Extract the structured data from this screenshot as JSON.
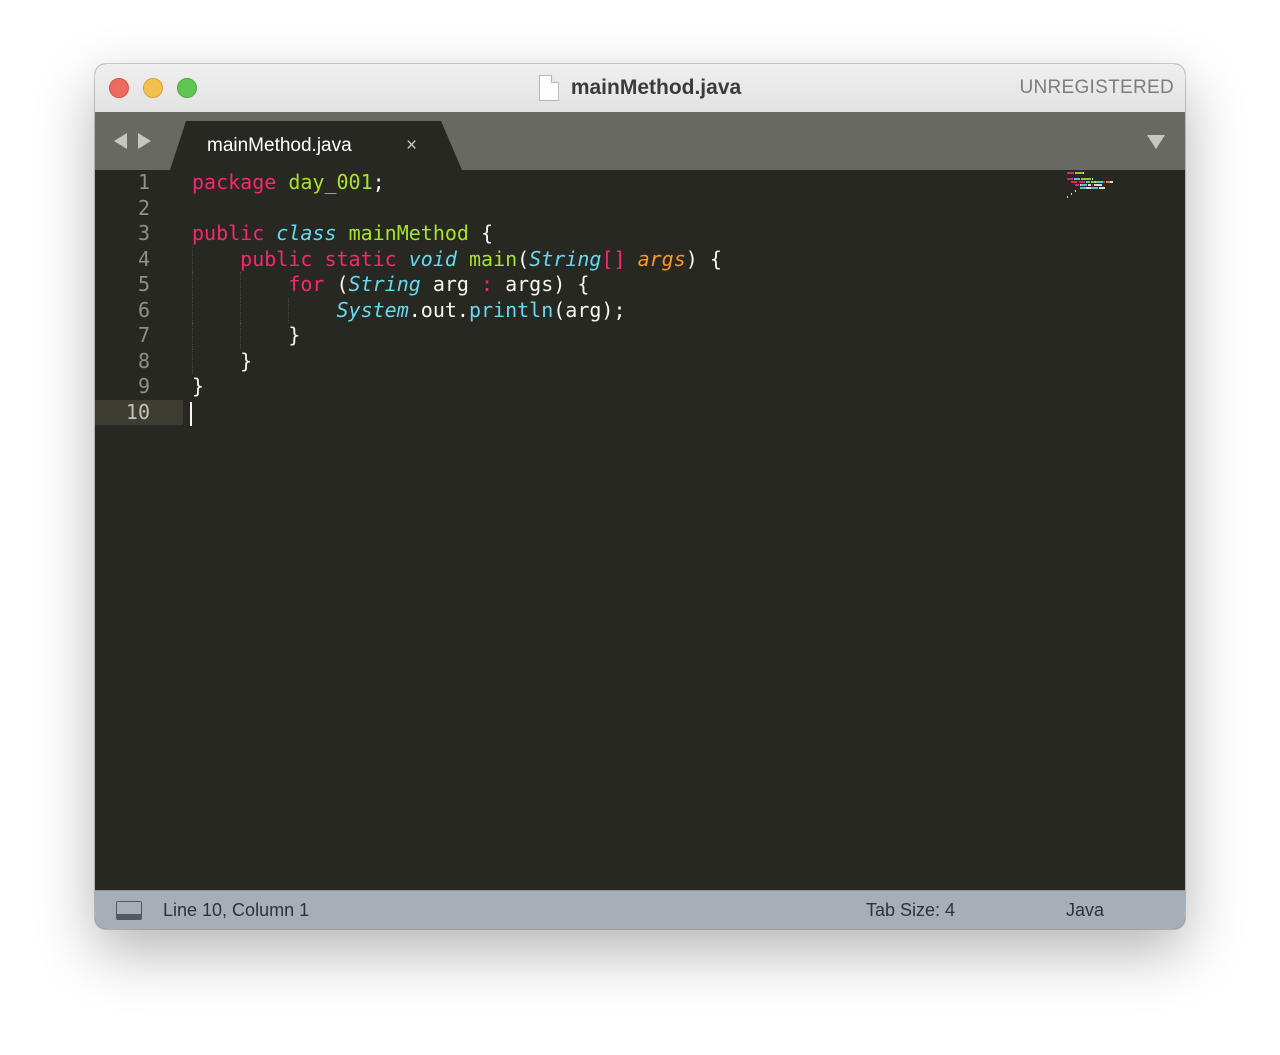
{
  "window": {
    "title": "mainMethod.java",
    "badge": "UNREGISTERED",
    "icons": [
      "close-icon",
      "minimize-icon",
      "zoom-icon",
      "document-icon"
    ]
  },
  "tabbar": {
    "tabs": [
      {
        "label": "mainMethod.java",
        "close_glyph": "×",
        "active": true
      }
    ],
    "icons": [
      "arrow-left-icon",
      "arrow-right-icon",
      "tab-menu-icon"
    ]
  },
  "editor": {
    "line_numbers": [
      "1",
      "2",
      "3",
      "4",
      "5",
      "6",
      "7",
      "8",
      "9",
      "10"
    ],
    "active_line": 10,
    "lines": [
      [
        {
          "t": "package",
          "c": "k"
        },
        {
          "t": " "
        },
        {
          "t": "day_001",
          "c": "n"
        },
        {
          "t": ";"
        }
      ],
      [],
      [
        {
          "t": "public",
          "c": "k"
        },
        {
          "t": " "
        },
        {
          "t": "class",
          "c": "t"
        },
        {
          "t": " "
        },
        {
          "t": "mainMethod",
          "c": "n"
        },
        {
          "t": " {"
        }
      ],
      [
        {
          "t": "    "
        },
        {
          "t": "public",
          "c": "k"
        },
        {
          "t": " "
        },
        {
          "t": "static",
          "c": "k"
        },
        {
          "t": " "
        },
        {
          "t": "void",
          "c": "t"
        },
        {
          "t": " "
        },
        {
          "t": "main",
          "c": "n"
        },
        {
          "t": "("
        },
        {
          "t": "String",
          "c": "t"
        },
        {
          "t": "[]",
          "c": "k"
        },
        {
          "t": " "
        },
        {
          "t": "args",
          "c": "p"
        },
        {
          "t": ") {"
        }
      ],
      [
        {
          "t": "        "
        },
        {
          "t": "for",
          "c": "k"
        },
        {
          "t": " ("
        },
        {
          "t": "String",
          "c": "t"
        },
        {
          "t": " arg "
        },
        {
          "t": ":",
          "c": "op"
        },
        {
          "t": " args) {"
        }
      ],
      [
        {
          "t": "            "
        },
        {
          "t": "System",
          "c": "t"
        },
        {
          "t": ".out."
        },
        {
          "t": "println",
          "c": "f"
        },
        {
          "t": "(arg);"
        }
      ],
      [
        {
          "t": "        }"
        }
      ],
      [
        {
          "t": "    }"
        }
      ],
      [
        {
          "t": "}"
        }
      ],
      []
    ],
    "colors": {
      "background": "#272822",
      "keyword": "#f92672",
      "type": "#66d9ef",
      "name": "#a6e22e",
      "parameter": "#fd971f",
      "plain": "#f8f8f2"
    }
  },
  "statusbar": {
    "position": "Line 10, Column 1",
    "tab_size": "Tab Size: 4",
    "syntax": "Java",
    "icons": [
      "panel-toggle-icon"
    ]
  }
}
